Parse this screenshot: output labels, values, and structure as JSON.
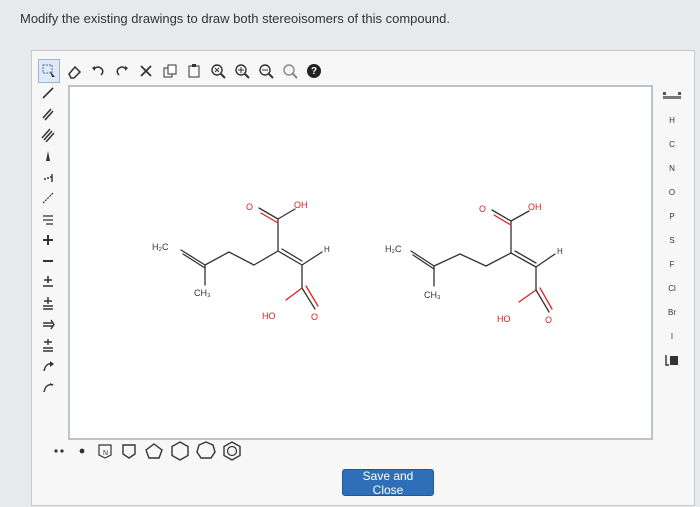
{
  "question": "Modify the existing drawings to draw both stereoisomers of this compound.",
  "save_button": "Save and Close",
  "colors": {
    "accent": "#2e6fb8",
    "oxygen": "#e02020",
    "bond": "#333333"
  },
  "top_toolbar": [
    "select-lasso-icon",
    "eraser-icon",
    "undo-icon",
    "redo-icon",
    "cut-icon",
    "copy-icon",
    "paste-icon",
    "zoom-fit-icon",
    "zoom-in-icon",
    "zoom-out-icon",
    "zoom-reset-icon",
    "help-icon"
  ],
  "help_label": "?",
  "left_tools": [
    "/",
    "//",
    "///",
    "1",
    "-1",
    "/",
    "N",
    "+",
    "-",
    "+",
    "+",
    "+",
    "+",
    "↷",
    "↷"
  ],
  "elements": [
    "H",
    "C",
    "N",
    "O",
    "P",
    "S",
    "F",
    "Cl",
    "Br",
    "I"
  ],
  "molecules": [
    {
      "atoms": {
        "o_top": "O",
        "oh_top": "OH",
        "h": "H",
        "h2c": "H₂C",
        "ch3": "CH₃",
        "ho": "HO",
        "o_bottom": "O"
      }
    },
    {
      "atoms": {
        "o_top": "O",
        "oh_top": "OH",
        "h": "H",
        "h2c": "H₂C",
        "ch3": "CH₃",
        "ho": "HO",
        "o_bottom": "O"
      }
    }
  ]
}
